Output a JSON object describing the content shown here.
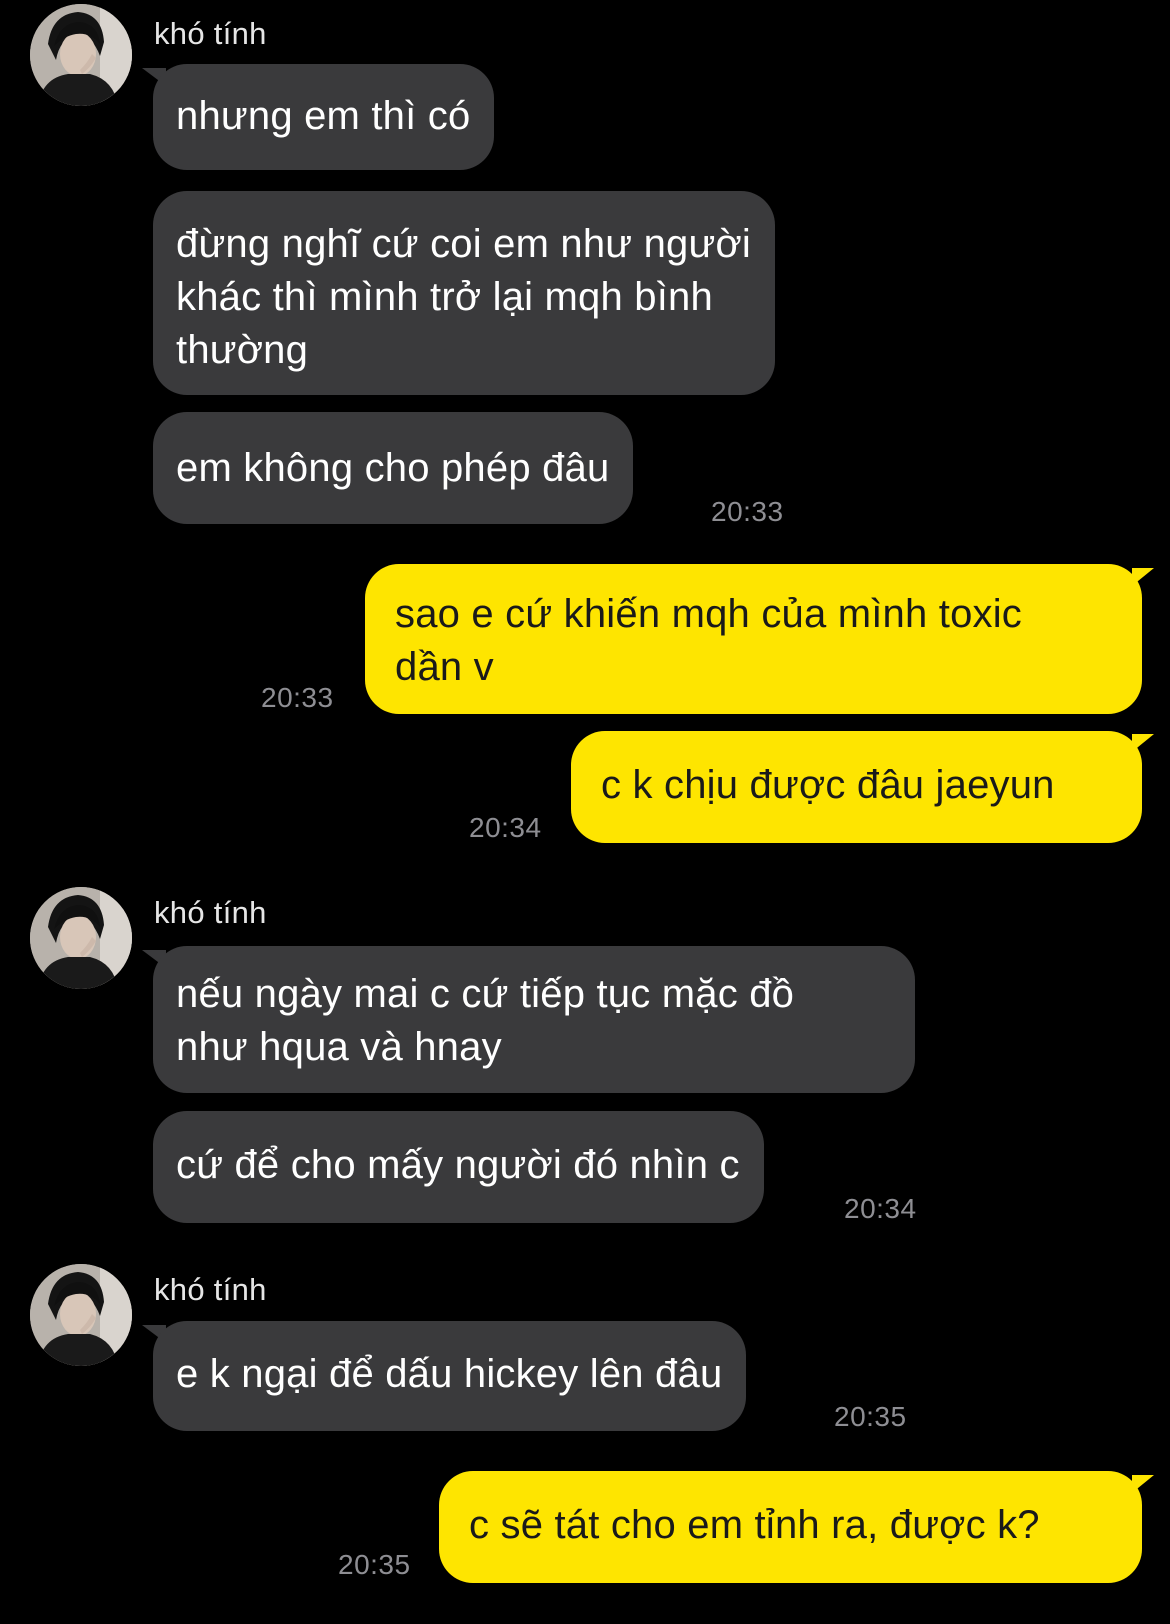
{
  "colors": {
    "background": "#000000",
    "incoming_bubble": "#3a3a3c",
    "outgoing_bubble": "#fee500",
    "timestamp": "#8e8e93"
  },
  "contact": {
    "name": "khó tính",
    "avatar_icon": "profile-photo"
  },
  "messages": {
    "m1": {
      "text": "nhưng em thì có"
    },
    "m2": {
      "line1": "đừng nghĩ cứ coi em như người",
      "line2": "khác thì mình trở lại mqh bình",
      "line3": "thường"
    },
    "m3": {
      "text": "em không cho phép đâu",
      "time": "20:33"
    },
    "m4": {
      "line1": "sao e cứ khiến mqh của mình toxic",
      "line2": "dần v",
      "time": "20:33"
    },
    "m5": {
      "text": "c k chịu được đâu jaeyun",
      "time": "20:34"
    },
    "m6": {
      "line1": "nếu ngày mai c cứ tiếp tục mặc đồ",
      "line2": "như hqua và hnay"
    },
    "m7": {
      "text": "cứ để cho mấy người đó nhìn c",
      "time": "20:34"
    },
    "m8": {
      "text": "e k ngại để dấu hickey lên đâu",
      "time": "20:35"
    },
    "m9": {
      "text": "c sẽ tát cho em tỉnh ra, được k?",
      "time": "20:35"
    }
  }
}
